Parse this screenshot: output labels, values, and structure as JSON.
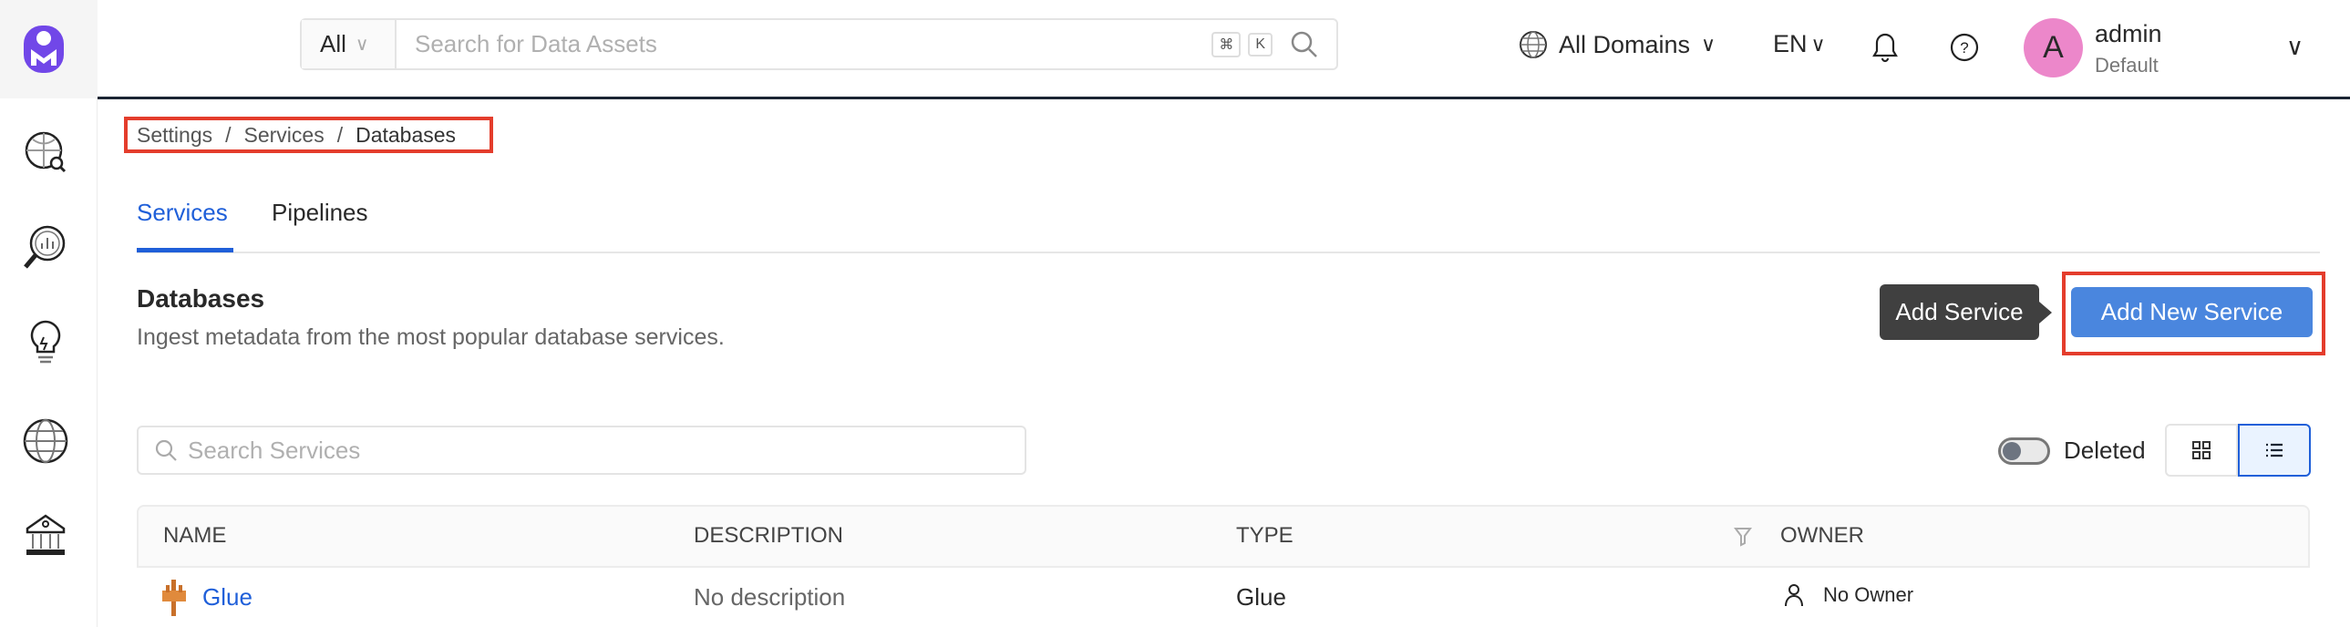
{
  "header": {
    "search": {
      "scope": "All",
      "placeholder": "Search for Data Assets",
      "shortcut_keys": [
        "⌘",
        "K"
      ]
    },
    "domain_selector": "All Domains",
    "language": "EN",
    "user": {
      "avatar_letter": "A",
      "name": "admin",
      "role": "Default",
      "avatar_color": "#ec87ca"
    }
  },
  "sidebar": {
    "items": [
      {
        "icon": "explore-globe-search-icon"
      },
      {
        "icon": "data-insights-icon"
      },
      {
        "icon": "lightbulb-icon"
      },
      {
        "icon": "domains-globe-icon"
      },
      {
        "icon": "governance-bank-icon"
      }
    ]
  },
  "breadcrumb": [
    "Settings",
    "Services",
    "Databases"
  ],
  "tabs": [
    {
      "label": "Services",
      "active": true
    },
    {
      "label": "Pipelines",
      "active": false
    }
  ],
  "page": {
    "title": "Databases",
    "subtitle": "Ingest metadata from the most popular database services.",
    "tooltip": "Add Service",
    "add_button": "Add New Service"
  },
  "filters": {
    "search_placeholder": "Search Services",
    "deleted_label": "Deleted",
    "deleted_on": false,
    "view": "list"
  },
  "table": {
    "columns": [
      "NAME",
      "DESCRIPTION",
      "TYPE",
      "OWNER"
    ],
    "rows": [
      {
        "name": "Glue",
        "description": "No description",
        "type": "Glue",
        "owner": "No Owner"
      }
    ]
  },
  "colors": {
    "accent": "#1f5fd9",
    "button": "#4a86de",
    "highlight": "#e43d2c",
    "logo": "#7147e8"
  }
}
